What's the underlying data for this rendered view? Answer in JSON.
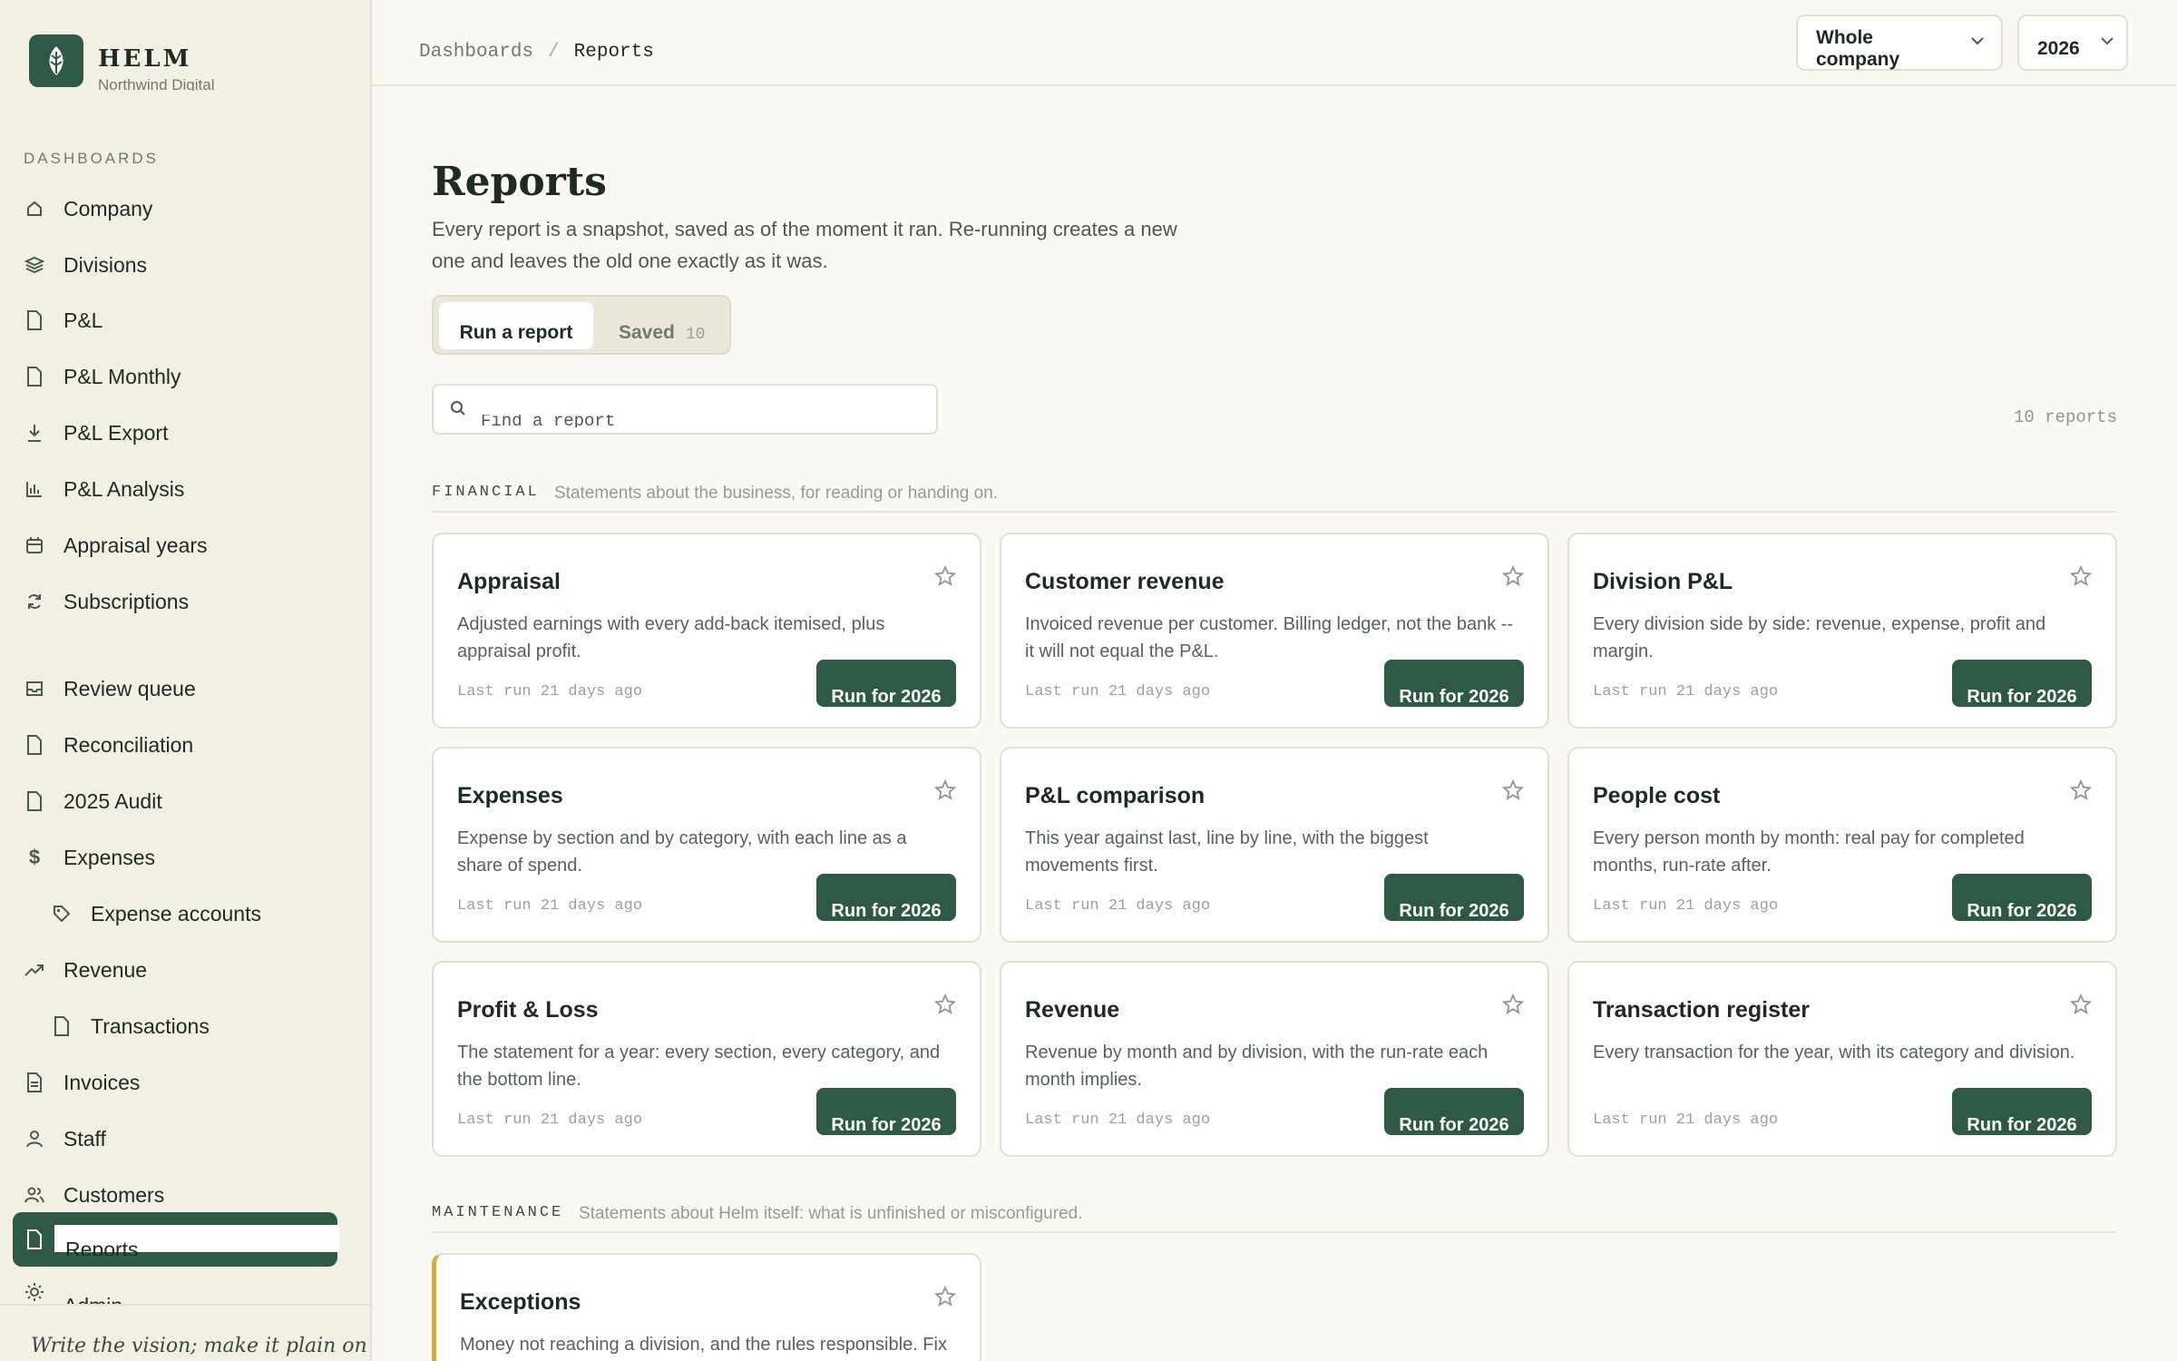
{
  "brand": {
    "name": "HELM",
    "org": "Northwind Digital"
  },
  "sidebar": {
    "section_label": "DASHBOARDS",
    "items": [
      {
        "label": "Company",
        "icon": "home-icon"
      },
      {
        "label": "Divisions",
        "icon": "layers-icon"
      },
      {
        "label": "P&L",
        "icon": "document-icon"
      },
      {
        "label": "P&L Monthly",
        "icon": "document-icon"
      },
      {
        "label": "P&L Export",
        "icon": "download-icon"
      },
      {
        "label": "P&L Analysis",
        "icon": "bar-chart-icon"
      },
      {
        "label": "Appraisal years",
        "icon": "calendar-icon"
      },
      {
        "label": "Subscriptions",
        "icon": "refresh-icon"
      },
      {
        "label": "Review queue",
        "icon": "inbox-icon"
      },
      {
        "label": "Reconciliation",
        "icon": "document-icon"
      },
      {
        "label": "2025 Audit",
        "icon": "document-icon"
      },
      {
        "label": "Expenses",
        "icon": "dollar-icon"
      },
      {
        "label": "Expense accounts",
        "icon": "tag-icon"
      },
      {
        "label": "Revenue",
        "icon": "trend-up-icon"
      },
      {
        "label": "Transactions",
        "icon": "document-icon"
      },
      {
        "label": "Invoices",
        "icon": "invoice-icon"
      },
      {
        "label": "Staff",
        "icon": "person-icon"
      },
      {
        "label": "Customers",
        "icon": "people-icon"
      },
      {
        "label": "Reports",
        "icon": "document-icon"
      },
      {
        "label": "Admin",
        "icon": "gear-icon"
      }
    ],
    "footer_quote": "Write the vision; make it plain on"
  },
  "topbar": {
    "breadcrumb": {
      "parent": "Dashboards",
      "separator": "/",
      "current": "Reports"
    },
    "scope_select": "Whole company",
    "year_select": "2026"
  },
  "page": {
    "title": "Reports",
    "description": "Every report is a snapshot, saved as of the moment it ran. Re-running creates a new one and leaves the old one exactly as it was.",
    "tabs": {
      "run": "Run a report",
      "saved": "Saved",
      "saved_count": "10"
    },
    "search_placeholder": "Find a report",
    "report_count": "10 reports"
  },
  "sections": {
    "financial": {
      "label": "FINANCIAL",
      "desc": "Statements about the business, for reading or handing on."
    },
    "maintenance": {
      "label": "MAINTENANCE",
      "desc": "Statements about Helm itself: what is unfinished or misconfigured."
    }
  },
  "cards": [
    {
      "title": "Appraisal",
      "desc": "Adjusted earnings with every add-back itemised, plus appraisal profit.",
      "last_run": "Last run 21 days ago",
      "button": "Run for 2026"
    },
    {
      "title": "Customer revenue",
      "desc": "Invoiced revenue per customer. Billing ledger, not the bank -- it will not equal the P&L.",
      "last_run": "Last run 21 days ago",
      "button": "Run for 2026"
    },
    {
      "title": "Division P&L",
      "desc": "Every division side by side: revenue, expense, profit and margin.",
      "last_run": "Last run 21 days ago",
      "button": "Run for 2026"
    },
    {
      "title": "Expenses",
      "desc": "Expense by section and by category, with each line as a share of spend.",
      "last_run": "Last run 21 days ago",
      "button": "Run for 2026"
    },
    {
      "title": "P&L comparison",
      "desc": "This year against last, line by line, with the biggest movements first.",
      "last_run": "Last run 21 days ago",
      "button": "Run for 2026"
    },
    {
      "title": "People cost",
      "desc": "Every person month by month: real pay for completed months, run-rate after.",
      "last_run": "Last run 21 days ago",
      "button": "Run for 2026"
    },
    {
      "title": "Profit & Loss",
      "desc": "The statement for a year: every section, every category, and the bottom line.",
      "last_run": "Last run 21 days ago",
      "button": "Run for 2026"
    },
    {
      "title": "Revenue",
      "desc": "Revenue by month and by division, with the run-rate each month implies.",
      "last_run": "Last run 21 days ago",
      "button": "Run for 2026"
    },
    {
      "title": "Transaction register",
      "desc": "Every transaction for the year, with its category and division.",
      "last_run": "Last run 21 days ago",
      "button": "Run for 2026"
    }
  ],
  "exception_card": {
    "title": "Exceptions",
    "desc": "Money not reaching a division, and the rules responsible. Fix"
  },
  "colors": {
    "accent": "#2e5a45",
    "sidebar_bg": "#f2efe3",
    "page_bg": "#faf8f2",
    "warning_stripe": "#d4a94a"
  }
}
